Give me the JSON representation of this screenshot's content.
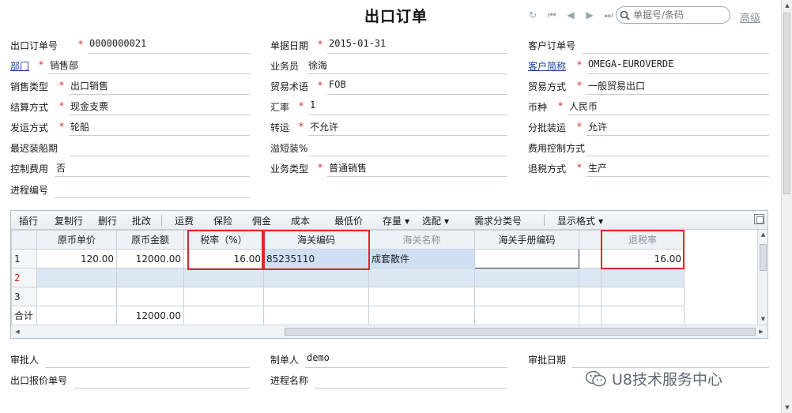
{
  "header": {
    "title": "出口订单",
    "search_placeholder": "单据号/条码",
    "advanced": "高级"
  },
  "form": {
    "order_no": {
      "label": "出口订单号",
      "value": "0000000021"
    },
    "doc_date": {
      "label": "单据日期",
      "value": "2015-01-31"
    },
    "customer_order_no": {
      "label": "客户订单号",
      "value": ""
    },
    "department": {
      "label": "部门",
      "value": "销售部"
    },
    "salesperson": {
      "label": "业务员",
      "value": "徐海"
    },
    "customer_short": {
      "label": "客户简称",
      "value": "OMEGA-EUROVERDE"
    },
    "sales_type": {
      "label": "销售类型",
      "value": "出口销售"
    },
    "trade_terms": {
      "label": "贸易术语",
      "value": "FOB"
    },
    "trade_mode": {
      "label": "贸易方式",
      "value": "一般贸易出口"
    },
    "settlement": {
      "label": "结算方式",
      "value": "现金支票"
    },
    "exchange_rate": {
      "label": "汇率",
      "value": "1"
    },
    "currency": {
      "label": "币种",
      "value": "人民币"
    },
    "shipping": {
      "label": "发运方式",
      "value": "轮船"
    },
    "transshipment": {
      "label": "转运",
      "value": "不允许"
    },
    "partial_shipment": {
      "label": "分批装运",
      "value": "允许"
    },
    "latest_shipping": {
      "label": "最迟装船期",
      "value": ""
    },
    "overflow": {
      "label": "溢短装%",
      "value": ""
    },
    "fee_control_mode": {
      "label": "费用控制方式",
      "value": ""
    },
    "fee_control": {
      "label": "控制费用",
      "value": "否"
    },
    "business_type": {
      "label": "业务类型",
      "value": "普通销售"
    },
    "tax_refund_mode": {
      "label": "退税方式",
      "value": "生产"
    },
    "process_no": {
      "label": "进程编号",
      "value": ""
    }
  },
  "toolbar": {
    "insert": "插行",
    "copy_row": "复制行",
    "delete_row": "删行",
    "batch_edit": "批改",
    "freight": "运费",
    "insurance": "保险",
    "commission": "佣金",
    "cost": "成本",
    "min_price": "最低价",
    "stock": "存量",
    "select": "选配",
    "demand_class_no": "需求分类号",
    "display_format": "显示格式"
  },
  "grid": {
    "columns": [
      "",
      "原币单价",
      "原币金额",
      "税率（%）",
      "海关编码",
      "海关名称",
      "海关手册编码",
      "",
      "退税率"
    ],
    "rows": [
      {
        "no": "1",
        "unit_price": "120.00",
        "amount": "12000.00",
        "tax_rate": "16.00",
        "customs_code": "85235110",
        "customs_name": "成套散件",
        "manual_code": "",
        "refund_rate": "16.00"
      },
      {
        "no": "2",
        "unit_price": "",
        "amount": "",
        "tax_rate": "",
        "customs_code": "",
        "customs_name": "",
        "manual_code": "",
        "refund_rate": ""
      },
      {
        "no": "3",
        "unit_price": "",
        "amount": "",
        "tax_rate": "",
        "customs_code": "",
        "customs_name": "",
        "manual_code": "",
        "refund_rate": ""
      }
    ],
    "total": {
      "label": "合计",
      "amount": "12000.00"
    }
  },
  "footer": {
    "approver": {
      "label": "审批人",
      "value": ""
    },
    "maker": {
      "label": "制单人",
      "value": "demo"
    },
    "approve_date": {
      "label": "审批日期",
      "value": ""
    },
    "quote_no": {
      "label": "出口报价单号",
      "value": ""
    },
    "process_name": {
      "label": "进程名称",
      "value": ""
    }
  },
  "watermark": "U8技术服务中心"
}
